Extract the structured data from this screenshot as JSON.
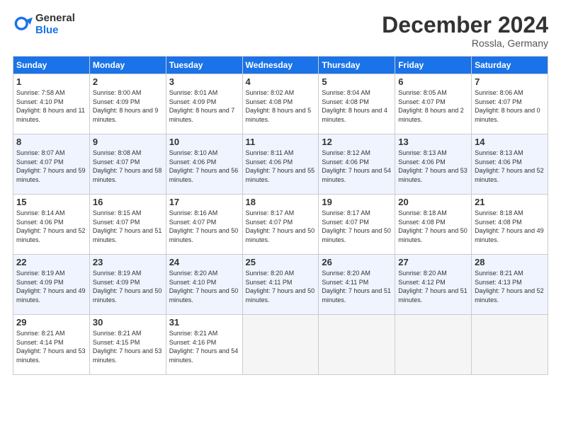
{
  "header": {
    "logo_general": "General",
    "logo_blue": "Blue",
    "month": "December 2024",
    "location": "Rossla, Germany"
  },
  "days_of_week": [
    "Sunday",
    "Monday",
    "Tuesday",
    "Wednesday",
    "Thursday",
    "Friday",
    "Saturday"
  ],
  "weeks": [
    [
      {
        "day": 1,
        "sunrise": "Sunrise: 7:58 AM",
        "sunset": "Sunset: 4:10 PM",
        "daylight": "Daylight: 8 hours and 11 minutes."
      },
      {
        "day": 2,
        "sunrise": "Sunrise: 8:00 AM",
        "sunset": "Sunset: 4:09 PM",
        "daylight": "Daylight: 8 hours and 9 minutes."
      },
      {
        "day": 3,
        "sunrise": "Sunrise: 8:01 AM",
        "sunset": "Sunset: 4:09 PM",
        "daylight": "Daylight: 8 hours and 7 minutes."
      },
      {
        "day": 4,
        "sunrise": "Sunrise: 8:02 AM",
        "sunset": "Sunset: 4:08 PM",
        "daylight": "Daylight: 8 hours and 5 minutes."
      },
      {
        "day": 5,
        "sunrise": "Sunrise: 8:04 AM",
        "sunset": "Sunset: 4:08 PM",
        "daylight": "Daylight: 8 hours and 4 minutes."
      },
      {
        "day": 6,
        "sunrise": "Sunrise: 8:05 AM",
        "sunset": "Sunset: 4:07 PM",
        "daylight": "Daylight: 8 hours and 2 minutes."
      },
      {
        "day": 7,
        "sunrise": "Sunrise: 8:06 AM",
        "sunset": "Sunset: 4:07 PM",
        "daylight": "Daylight: 8 hours and 0 minutes."
      }
    ],
    [
      {
        "day": 8,
        "sunrise": "Sunrise: 8:07 AM",
        "sunset": "Sunset: 4:07 PM",
        "daylight": "Daylight: 7 hours and 59 minutes."
      },
      {
        "day": 9,
        "sunrise": "Sunrise: 8:08 AM",
        "sunset": "Sunset: 4:07 PM",
        "daylight": "Daylight: 7 hours and 58 minutes."
      },
      {
        "day": 10,
        "sunrise": "Sunrise: 8:10 AM",
        "sunset": "Sunset: 4:06 PM",
        "daylight": "Daylight: 7 hours and 56 minutes."
      },
      {
        "day": 11,
        "sunrise": "Sunrise: 8:11 AM",
        "sunset": "Sunset: 4:06 PM",
        "daylight": "Daylight: 7 hours and 55 minutes."
      },
      {
        "day": 12,
        "sunrise": "Sunrise: 8:12 AM",
        "sunset": "Sunset: 4:06 PM",
        "daylight": "Daylight: 7 hours and 54 minutes."
      },
      {
        "day": 13,
        "sunrise": "Sunrise: 8:13 AM",
        "sunset": "Sunset: 4:06 PM",
        "daylight": "Daylight: 7 hours and 53 minutes."
      },
      {
        "day": 14,
        "sunrise": "Sunrise: 8:13 AM",
        "sunset": "Sunset: 4:06 PM",
        "daylight": "Daylight: 7 hours and 52 minutes."
      }
    ],
    [
      {
        "day": 15,
        "sunrise": "Sunrise: 8:14 AM",
        "sunset": "Sunset: 4:06 PM",
        "daylight": "Daylight: 7 hours and 52 minutes."
      },
      {
        "day": 16,
        "sunrise": "Sunrise: 8:15 AM",
        "sunset": "Sunset: 4:07 PM",
        "daylight": "Daylight: 7 hours and 51 minutes."
      },
      {
        "day": 17,
        "sunrise": "Sunrise: 8:16 AM",
        "sunset": "Sunset: 4:07 PM",
        "daylight": "Daylight: 7 hours and 50 minutes."
      },
      {
        "day": 18,
        "sunrise": "Sunrise: 8:17 AM",
        "sunset": "Sunset: 4:07 PM",
        "daylight": "Daylight: 7 hours and 50 minutes."
      },
      {
        "day": 19,
        "sunrise": "Sunrise: 8:17 AM",
        "sunset": "Sunset: 4:07 PM",
        "daylight": "Daylight: 7 hours and 50 minutes."
      },
      {
        "day": 20,
        "sunrise": "Sunrise: 8:18 AM",
        "sunset": "Sunset: 4:08 PM",
        "daylight": "Daylight: 7 hours and 50 minutes."
      },
      {
        "day": 21,
        "sunrise": "Sunrise: 8:18 AM",
        "sunset": "Sunset: 4:08 PM",
        "daylight": "Daylight: 7 hours and 49 minutes."
      }
    ],
    [
      {
        "day": 22,
        "sunrise": "Sunrise: 8:19 AM",
        "sunset": "Sunset: 4:09 PM",
        "daylight": "Daylight: 7 hours and 49 minutes."
      },
      {
        "day": 23,
        "sunrise": "Sunrise: 8:19 AM",
        "sunset": "Sunset: 4:09 PM",
        "daylight": "Daylight: 7 hours and 50 minutes."
      },
      {
        "day": 24,
        "sunrise": "Sunrise: 8:20 AM",
        "sunset": "Sunset: 4:10 PM",
        "daylight": "Daylight: 7 hours and 50 minutes."
      },
      {
        "day": 25,
        "sunrise": "Sunrise: 8:20 AM",
        "sunset": "Sunset: 4:11 PM",
        "daylight": "Daylight: 7 hours and 50 minutes."
      },
      {
        "day": 26,
        "sunrise": "Sunrise: 8:20 AM",
        "sunset": "Sunset: 4:11 PM",
        "daylight": "Daylight: 7 hours and 51 minutes."
      },
      {
        "day": 27,
        "sunrise": "Sunrise: 8:20 AM",
        "sunset": "Sunset: 4:12 PM",
        "daylight": "Daylight: 7 hours and 51 minutes."
      },
      {
        "day": 28,
        "sunrise": "Sunrise: 8:21 AM",
        "sunset": "Sunset: 4:13 PM",
        "daylight": "Daylight: 7 hours and 52 minutes."
      }
    ],
    [
      {
        "day": 29,
        "sunrise": "Sunrise: 8:21 AM",
        "sunset": "Sunset: 4:14 PM",
        "daylight": "Daylight: 7 hours and 53 minutes."
      },
      {
        "day": 30,
        "sunrise": "Sunrise: 8:21 AM",
        "sunset": "Sunset: 4:15 PM",
        "daylight": "Daylight: 7 hours and 53 minutes."
      },
      {
        "day": 31,
        "sunrise": "Sunrise: 8:21 AM",
        "sunset": "Sunset: 4:16 PM",
        "daylight": "Daylight: 7 hours and 54 minutes."
      },
      null,
      null,
      null,
      null
    ]
  ]
}
